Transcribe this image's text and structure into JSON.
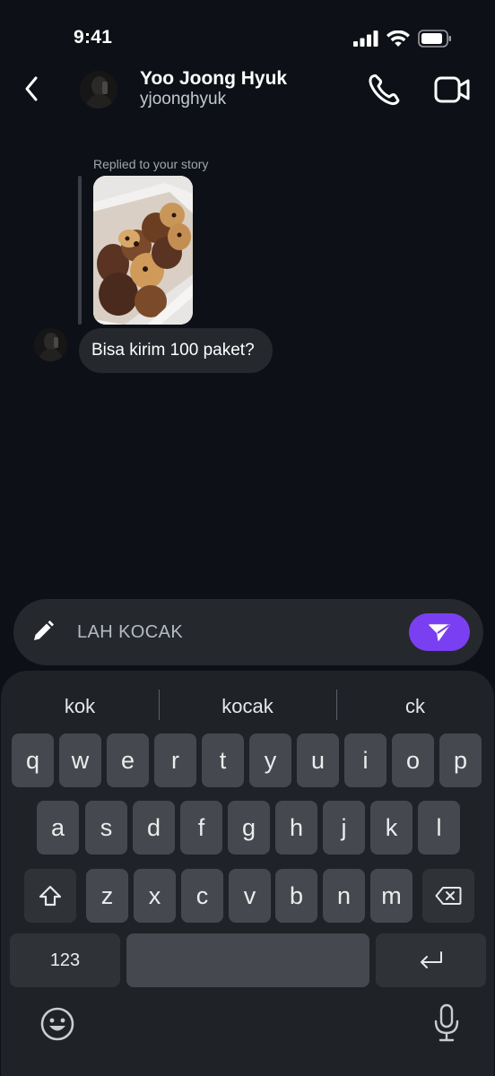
{
  "status_bar": {
    "time": "9:41",
    "icons": [
      "signal-icon",
      "wifi-icon",
      "battery-icon"
    ]
  },
  "header": {
    "back_icon": "chevron-left-icon",
    "contact_name": "Yoo Joong Hyuk",
    "username": "yjoonghyuk",
    "call_icon": "phone-icon",
    "video_icon": "video-camera-icon"
  },
  "chat": {
    "reply_label": "Replied to your story",
    "message_text": "Bisa kirim 100 paket?"
  },
  "composer": {
    "value": "LAH KOCAK",
    "pencil_icon": "pencil-icon",
    "send_icon": "send-icon",
    "send_color": "#7b3ff2"
  },
  "keyboard": {
    "suggestions": [
      "kok",
      "kocak",
      "ck"
    ],
    "row1": [
      "q",
      "w",
      "e",
      "r",
      "t",
      "y",
      "u",
      "i",
      "o",
      "p"
    ],
    "row2": [
      "a",
      "s",
      "d",
      "f",
      "g",
      "h",
      "j",
      "k",
      "l"
    ],
    "row3": [
      "z",
      "x",
      "c",
      "v",
      "b",
      "n",
      "m"
    ],
    "numbers_key": "123",
    "shift_icon": "shift-icon",
    "backspace_icon": "backspace-icon",
    "return_icon": "return-icon",
    "emoji_icon": "emoji-icon",
    "mic_icon": "microphone-icon"
  }
}
